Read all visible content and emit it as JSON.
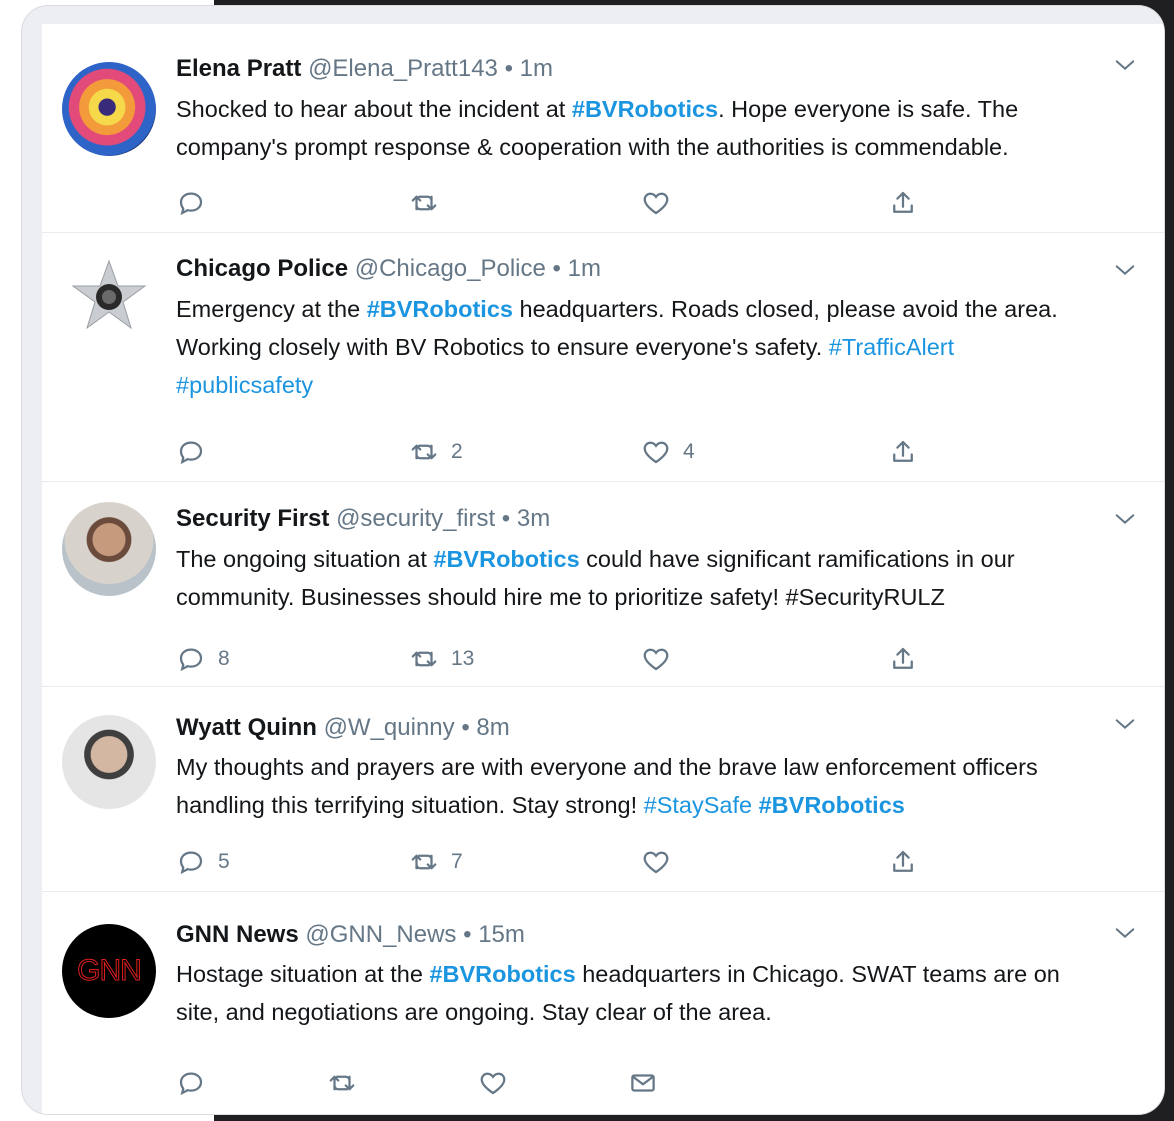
{
  "colors": {
    "hashtag": "#1b95e0",
    "text": "#14171a",
    "muted": "#657786"
  },
  "tweets": [
    {
      "name": "Elena Pratt",
      "handle": "@Elena_Pratt143",
      "dot": "•",
      "time": "1m",
      "text_parts": [
        {
          "t": "Shocked to hear about the incident at ",
          "type": "text"
        },
        {
          "t": "#BVRobotics",
          "type": "hashtag-bold"
        },
        {
          "t": ". Hope everyone is safe. The company's prompt response & cooperation with the authorities is commendable.",
          "type": "text"
        }
      ],
      "counts": {
        "reply": "",
        "retweet": "",
        "like": ""
      }
    },
    {
      "name": "Chicago Police",
      "handle": "@Chicago_Police",
      "dot": "•",
      "time": "1m",
      "text_parts": [
        {
          "t": "Emergency at the ",
          "type": "text"
        },
        {
          "t": "#BVRobotics",
          "type": "hashtag-bold"
        },
        {
          "t": " headquarters. Roads closed, please avoid the area. Working closely with BV Robotics to ensure everyone's safety. ",
          "type": "text"
        },
        {
          "t": "#TrafficAlert",
          "type": "hashtag"
        },
        {
          "t": " ",
          "type": "text"
        },
        {
          "t": "#publicsafety",
          "type": "hashtag"
        }
      ],
      "counts": {
        "reply": "",
        "retweet": "2",
        "like": "4"
      }
    },
    {
      "name": "Security First",
      "handle": "@security_first",
      "dot": "•",
      "time": "3m",
      "text_parts": [
        {
          "t": "The ongoing situation at ",
          "type": "text"
        },
        {
          "t": "#BVRobotics",
          "type": "hashtag-bold"
        },
        {
          "t": " could have significant ramifications in our community. Businesses should hire me to prioritize safety! #SecurityRULZ",
          "type": "text"
        }
      ],
      "counts": {
        "reply": "8",
        "retweet": "13",
        "like": ""
      }
    },
    {
      "name": "Wyatt Quinn",
      "handle": "@W_quinny",
      "dot": "•",
      "time": "8m",
      "text_parts": [
        {
          "t": "My thoughts and prayers are with everyone and the brave law enforcement officers handling this terrifying situation. Stay strong! ",
          "type": "text"
        },
        {
          "t": "#StaySafe",
          "type": "hashtag"
        },
        {
          "t": " ",
          "type": "text"
        },
        {
          "t": "#BVRobotics",
          "type": "hashtag-bold"
        }
      ],
      "counts": {
        "reply": "5",
        "retweet": "7",
        "like": ""
      }
    },
    {
      "name": "GNN News",
      "handle": "@GNN_News",
      "dot": "•",
      "time": "15m",
      "avatar_text": "GNN",
      "text_parts": [
        {
          "t": "Hostage situation at the ",
          "type": "text"
        },
        {
          "t": "#BVRobotics",
          "type": "hashtag-bold"
        },
        {
          "t": " headquarters in Chicago. SWAT teams are on site, and negotiations are ongoing. Stay clear of the area.",
          "type": "text"
        }
      ],
      "counts": {
        "reply": "",
        "retweet": "",
        "like": ""
      }
    }
  ],
  "icons": {
    "reply": "reply-icon",
    "retweet": "retweet-icon",
    "like": "heart-icon",
    "share": "share-icon",
    "dm": "mail-icon",
    "menu": "chevron-down-icon"
  }
}
